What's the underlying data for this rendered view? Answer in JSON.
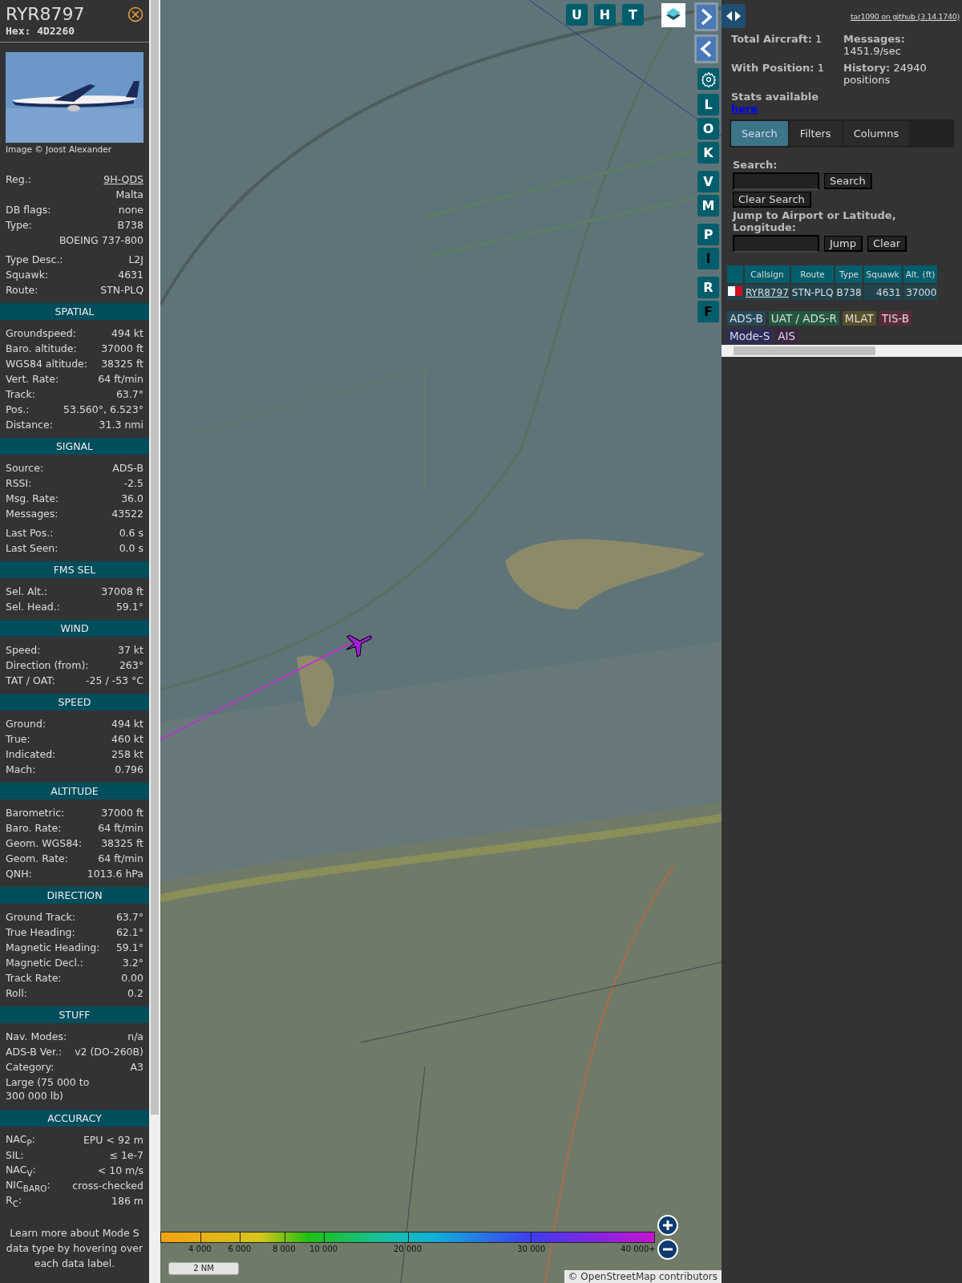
{
  "aircraft": {
    "callsign": "RYR8797",
    "hex_label": "Hex:",
    "hex": "4D2260",
    "photo_credit": "Image © Joost Alexander"
  },
  "details": [
    {
      "kind": "link",
      "label": "Reg.:",
      "value": "9H-QDS"
    },
    {
      "kind": "value_only",
      "value": "Malta"
    },
    {
      "kind": "plain",
      "label": "DB flags:",
      "value": "none"
    },
    {
      "kind": "plain",
      "label": "Type:",
      "value": "B738"
    },
    {
      "kind": "value_only",
      "value": "BOEING 737-800"
    },
    {
      "kind": "spaced",
      "label": "Type Desc.:",
      "value": "L2J"
    },
    {
      "kind": "plain",
      "label": "Squawk:",
      "value": "4631"
    },
    {
      "kind": "plain",
      "label": "Route:",
      "value": "STN-PLQ"
    }
  ],
  "sections": [
    {
      "title": "SPATIAL",
      "rows": [
        {
          "kind": "plain",
          "label": "Groundspeed:",
          "value": "494 kt"
        },
        {
          "kind": "plain",
          "label": "Baro. altitude:",
          "value": "37000 ft"
        },
        {
          "kind": "plain",
          "label": "WGS84 altitude:",
          "value": "38325 ft"
        },
        {
          "kind": "plain",
          "label": "Vert. Rate:",
          "value": "64 ft/min"
        },
        {
          "kind": "plain",
          "label": "Track:",
          "value": "63.7°"
        },
        {
          "kind": "plain",
          "label": "Pos.:",
          "value": "53.560°, 6.523°"
        },
        {
          "kind": "plain",
          "label": "Distance:",
          "value": "31.3 nmi"
        }
      ]
    },
    {
      "title": "SIGNAL",
      "rows": [
        {
          "kind": "plain",
          "label": "Source:",
          "value": "ADS-B"
        },
        {
          "kind": "plain",
          "label": "RSSI:",
          "value": "-2.5"
        },
        {
          "kind": "plain",
          "label": "Msg. Rate:",
          "value": "36.0"
        },
        {
          "kind": "plain",
          "label": "Messages:",
          "value": "43522"
        },
        {
          "kind": "spaced",
          "label": "Last Pos.:",
          "value": "0.6 s"
        },
        {
          "kind": "plain",
          "label": "Last Seen:",
          "value": "0.0 s"
        }
      ]
    },
    {
      "title": "FMS SEL",
      "rows": [
        {
          "kind": "plain",
          "label": "Sel. Alt.:",
          "value": "37008 ft"
        },
        {
          "kind": "plain",
          "label": "Sel. Head.:",
          "value": "59.1°"
        }
      ]
    },
    {
      "title": "WIND",
      "rows": [
        {
          "kind": "plain",
          "label": "Speed:",
          "value": "37 kt"
        },
        {
          "kind": "plain",
          "label": "Direction (from):",
          "value": "263°"
        },
        {
          "kind": "plain",
          "label": "TAT / OAT:",
          "value": "-25 / -53 °C"
        }
      ]
    },
    {
      "title": "SPEED",
      "rows": [
        {
          "kind": "plain",
          "label": "Ground:",
          "value": "494 kt"
        },
        {
          "kind": "plain",
          "label": "True:",
          "value": "460 kt"
        },
        {
          "kind": "plain",
          "label": "Indicated:",
          "value": "258 kt"
        },
        {
          "kind": "plain",
          "label": "Mach:",
          "value": "0.796"
        }
      ]
    },
    {
      "title": "ALTITUDE",
      "rows": [
        {
          "kind": "plain",
          "label": "Barometric:",
          "value": "37000 ft"
        },
        {
          "kind": "plain",
          "label": "Baro. Rate:",
          "value": "64 ft/min"
        },
        {
          "kind": "plain",
          "label": "Geom. WGS84:",
          "value": "38325 ft"
        },
        {
          "kind": "plain",
          "label": "Geom. Rate:",
          "value": "64 ft/min"
        },
        {
          "kind": "plain",
          "label": "QNH:",
          "value": "1013.6 hPa"
        }
      ]
    },
    {
      "title": "DIRECTION",
      "rows": [
        {
          "kind": "plain",
          "label": "Ground Track:",
          "value": "63.7°"
        },
        {
          "kind": "plain",
          "label": "True Heading:",
          "value": "62.1°"
        },
        {
          "kind": "plain",
          "label": "Magnetic Heading:",
          "value": "59.1°"
        },
        {
          "kind": "plain",
          "label": "Magnetic Decl.:",
          "value": "3.2°"
        },
        {
          "kind": "plain",
          "label": "Track Rate:",
          "value": "0.00"
        },
        {
          "kind": "plain",
          "label": "Roll:",
          "value": "0.2"
        }
      ]
    },
    {
      "title": "STUFF",
      "rows": [
        {
          "kind": "plain",
          "label": "Nav. Modes:",
          "value": "n/a"
        },
        {
          "kind": "plain",
          "label": "ADS-B Ver.:",
          "value": "v2 (DO-260B)"
        },
        {
          "kind": "plain",
          "label": "Category:",
          "value": "A3"
        },
        {
          "kind": "note",
          "value": "Large (75 000 to 300 000 lb)"
        }
      ]
    },
    {
      "title": "ACCURACY",
      "rows": [
        {
          "kind": "plain",
          "label": "NAC$_{P}$:",
          "value": "EPU < 92 m"
        },
        {
          "kind": "plain",
          "label": "SIL:",
          "value": "≤ 1e-7"
        },
        {
          "kind": "plain",
          "label": "NAC$_{V}$:",
          "value": "< 10 m/s"
        },
        {
          "kind": "plain",
          "label": "NIC$_{BARO}$:",
          "value": "cross-checked"
        },
        {
          "kind": "plain",
          "label": "R$_{C}$:",
          "value": "186 m"
        }
      ]
    }
  ],
  "footer": "Learn more about Mode S data type by hovering over each data label.",
  "map": {
    "top_buttons": [
      "U",
      "H",
      "T"
    ],
    "side_buttons": [
      {
        "kind": "letter",
        "label": "L",
        "on": true
      },
      {
        "kind": "letter",
        "label": "O",
        "on": true
      },
      {
        "kind": "letter",
        "label": "K",
        "on": true
      },
      {
        "kind": "gap"
      },
      {
        "kind": "letter",
        "label": "V",
        "on": true
      },
      {
        "kind": "letter",
        "label": "M",
        "on": true
      },
      {
        "kind": "gap"
      },
      {
        "kind": "letter",
        "label": "P",
        "on": true
      },
      {
        "kind": "letter",
        "label": "I",
        "on": false
      },
      {
        "kind": "gap"
      },
      {
        "kind": "letter",
        "label": "R",
        "on": true
      },
      {
        "kind": "letter",
        "label": "F",
        "on": false
      }
    ],
    "legend": [
      "4 000",
      "6 000",
      "8 000",
      "10 000",
      "20 000",
      "30 000",
      "40 000+"
    ],
    "scale": "2 NM",
    "attribution": "© OpenStreetMap contributors"
  },
  "panel": {
    "link": "tar1090 on github (3.14.1740)",
    "stats": [
      {
        "label": "Total Aircraft:",
        "value": "1"
      },
      {
        "label": "Messages:",
        "value": "1451.9/sec"
      },
      {
        "label": "With Position:",
        "value": "1"
      },
      {
        "label": "History:",
        "value": "24940 positions"
      }
    ],
    "stats_note": "Stats available",
    "stats_link": "here",
    "tabs": [
      {
        "label": "Search",
        "selected": true
      },
      {
        "label": "Filters",
        "selected": false
      },
      {
        "label": "Columns",
        "selected": false
      }
    ],
    "search_label": "Search:",
    "search_button": "Search",
    "clear_search": "Clear Search",
    "jump_label": "Jump to Airport or Latitude, Longitude:",
    "jump_button": "Jump",
    "clear_button": "Clear",
    "table": {
      "columns": [
        "Callsign",
        "Route",
        "Type",
        "Squawk",
        "Alt. (ft)"
      ],
      "rows": [
        {
          "callsign": "RYR8797",
          "route": "STN-PLQ",
          "type": "B738",
          "squawk": "4631",
          "altitude": "37000"
        }
      ]
    },
    "sources": [
      {
        "label": "ADS-B",
        "color": "#27475a"
      },
      {
        "label": "UAT / ADS-R",
        "color": "#23563f"
      },
      {
        "label": "MLAT",
        "color": "#564f2b"
      },
      {
        "label": "TIS-B",
        "color": "#5b2a3a"
      },
      {
        "label": "Mode-S",
        "color": "#2b2c5c"
      },
      {
        "label": "AIS",
        "color": "#3d2444"
      }
    ]
  }
}
